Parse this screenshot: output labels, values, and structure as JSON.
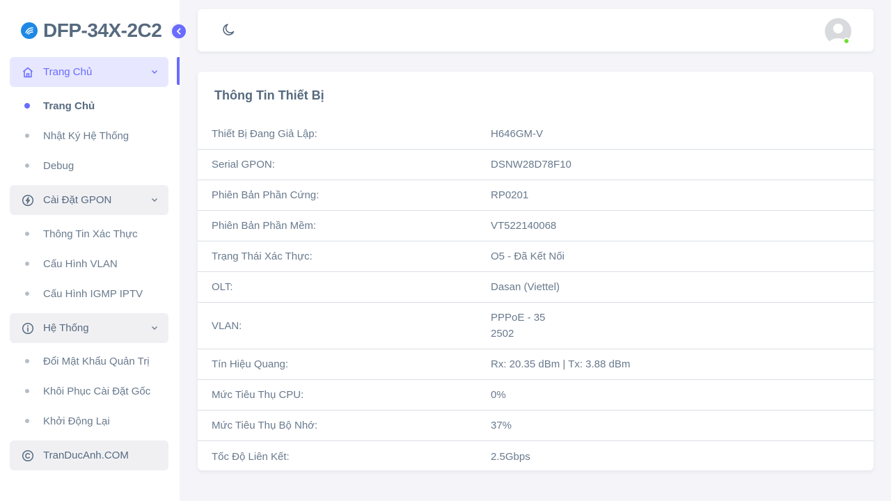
{
  "brand": {
    "title": "DFP-34X-2C2"
  },
  "sidebar": {
    "groups": [
      {
        "label": "Trang Chủ",
        "icon": "home-icon",
        "items": [
          {
            "label": "Trang Chủ",
            "active": true
          },
          {
            "label": "Nhật Ký Hệ Thống"
          },
          {
            "label": "Debug"
          }
        ]
      },
      {
        "label": "Cài Đặt GPON",
        "icon": "bolt-icon",
        "items": [
          {
            "label": "Thông Tin Xác Thực"
          },
          {
            "label": "Cấu Hình VLAN"
          },
          {
            "label": "Cấu Hình IGMP IPTV"
          }
        ]
      },
      {
        "label": "Hệ Thống",
        "icon": "info-icon",
        "items": [
          {
            "label": "Đổi Mật Khẩu Quản Trị"
          },
          {
            "label": "Khôi Phục Cài Đặt Gốc"
          },
          {
            "label": "Khởi Động Lại"
          }
        ]
      }
    ],
    "footer": {
      "label": "TranDucAnh.COM",
      "icon": "copyright-icon"
    }
  },
  "navbar": {
    "theme_icon": "moon-icon",
    "avatar_icon": "user-avatar-icon"
  },
  "card": {
    "title": "Thông Tin Thiết Bị",
    "rows": [
      {
        "key": "Thiết Bị Đang Giả Lập:",
        "value": "H646GM-V"
      },
      {
        "key": "Serial GPON:",
        "value": "DSNW28D78F10"
      },
      {
        "key": "Phiên Bản Phần Cứng:",
        "value": "RP0201"
      },
      {
        "key": "Phiên Bản Phần Mềm:",
        "value": "VT522140068"
      },
      {
        "key": "Trạng Thái Xác Thực:",
        "value": "O5 - Đã Kết Nối"
      },
      {
        "key": "OLT:",
        "value": "Dasan (Viettel)"
      },
      {
        "key": "VLAN:",
        "value": "PPPoE - 35",
        "value2": "2502"
      },
      {
        "key": "Tín Hiệu Quang:",
        "value": "Rx: 20.35 dBm | Tx: 3.88 dBm"
      },
      {
        "key": "Mức Tiêu Thụ CPU:",
        "value": "0%"
      },
      {
        "key": "Mức Tiêu Thụ Bộ Nhớ:",
        "value": "37%"
      },
      {
        "key": "Tốc Độ Liên Kết:",
        "value": "2.5Gbps"
      }
    ]
  },
  "colors": {
    "accent": "#696cff",
    "status_online": "#71dd37",
    "brand_logo": "#1e88e5"
  }
}
